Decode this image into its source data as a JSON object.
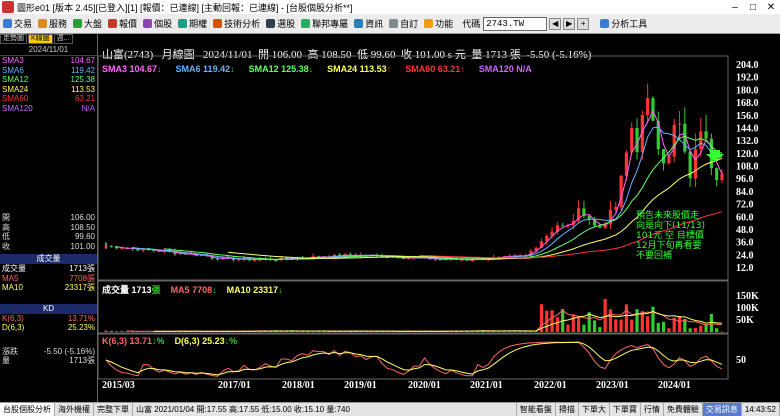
{
  "window": {
    "title": "圖形e01 [版本 2.45][已登入][1] [報價：已連線] [主動回報：已連線] - [台股個股分析**]"
  },
  "menu": {
    "items": [
      {
        "label": "交易",
        "icon": "trade-icon",
        "color": "#3a7bd5"
      },
      {
        "label": "服務",
        "icon": "service-icon",
        "color": "#e08a1e"
      },
      {
        "label": "大盤",
        "icon": "market-icon",
        "color": "#2a9d3a"
      },
      {
        "label": "報價",
        "icon": "quote-icon",
        "color": "#c0392b"
      },
      {
        "label": "個股",
        "icon": "stock-icon",
        "color": "#8e44ad"
      },
      {
        "label": "期權",
        "icon": "futures-icon",
        "color": "#16a085"
      },
      {
        "label": "技術分析",
        "icon": "chart-icon",
        "color": "#d35400"
      },
      {
        "label": "選股",
        "icon": "filter-icon",
        "color": "#2c3e50"
      },
      {
        "label": "聯邦專屬",
        "icon": "bank-icon",
        "color": "#27ae60"
      },
      {
        "label": "資訊",
        "icon": "info-icon",
        "color": "#2980b9"
      },
      {
        "label": "自訂",
        "icon": "custom-icon",
        "color": "#7f8c8d"
      },
      {
        "label": "功能",
        "icon": "function-icon",
        "color": "#f39c12"
      }
    ],
    "code_label": "代碼",
    "code_value": "2743.TW",
    "tools_label": "分析工具"
  },
  "left": {
    "tabs": [
      "走勢圖",
      "K線圖",
      "週..."
    ],
    "date": "2024/11/01",
    "ma_rows": [
      {
        "label": "SMA3",
        "value": "104.67",
        "color": "#ff66ff"
      },
      {
        "label": "SMA6",
        "value": "119.42",
        "color": "#66b3ff"
      },
      {
        "label": "SMA12",
        "value": "125.38",
        "color": "#66ff66"
      },
      {
        "label": "SMA24",
        "value": "113.53",
        "color": "#ffff66"
      },
      {
        "label": "SMA60",
        "value": "63.21",
        "color": "#ff3333"
      },
      {
        "label": "SMA120",
        "value": "N/A",
        "color": "#cc66ff"
      }
    ],
    "price_rows": [
      {
        "label": "開",
        "value": "106.00"
      },
      {
        "label": "高",
        "value": "108.50"
      },
      {
        "label": "低",
        "value": "99.60"
      },
      {
        "label": "收",
        "value": "101.00"
      }
    ],
    "vol_head": "成交量",
    "vol_rows": [
      {
        "label": "成交量",
        "value": "1713張",
        "color": "#ffffff"
      },
      {
        "label": "MA5",
        "value": "7708張",
        "color": "#ff6666"
      },
      {
        "label": "MA10",
        "value": "23317張",
        "color": "#ffff66"
      }
    ],
    "kd_head": "KD",
    "kd_rows": [
      {
        "label": "K(6,3)",
        "value": "13.71%",
        "color": "#ff6666"
      },
      {
        "label": "D(6,3)",
        "value": "25.23%",
        "color": "#ffff66"
      }
    ],
    "chg_rows": [
      {
        "label": "漲跌",
        "value": "-5.50 (-5.16%)"
      },
      {
        "label": "量",
        "value": "1713張"
      }
    ]
  },
  "header": {
    "stock": "山富(2743)",
    "period": "月線圖",
    "date": "2024/11/01",
    "open_label": "開",
    "open": "106.00",
    "high_label": "高",
    "high": "108.50",
    "low_label": "低",
    "low": "99.60",
    "close_label": "收",
    "close": "101.00",
    "unit": "s 元",
    "vol_label": "量",
    "vol": "1713 張",
    "change": "-5.50 (-5.16%)"
  },
  "legend": [
    {
      "text": "SMA3 104.67",
      "arrow": "↓",
      "color": "#ff66ff"
    },
    {
      "text": "SMA6 119.42",
      "arrow": "↓",
      "color": "#66b3ff"
    },
    {
      "text": "SMA12 125.38",
      "arrow": "↓",
      "color": "#66ff66"
    },
    {
      "text": "SMA24 113.53",
      "arrow": "↑",
      "color": "#ffff66"
    },
    {
      "text": "SMA60 63.21",
      "arrow": "↑",
      "color": "#ff3333"
    },
    {
      "text": "SMA120 N/A",
      "arrow": "",
      "color": "#cc66ff"
    }
  ],
  "price_axis": [
    "204.0",
    "192.0",
    "180.0",
    "168.0",
    "156.0",
    "144.0",
    "132.0",
    "120.0",
    "108.0",
    "96.0",
    "84.0",
    "72.0",
    "60.0",
    "48.0",
    "36.0",
    "24.0",
    "12.0"
  ],
  "vol_legend": {
    "vol": "成交量 1713",
    "vol_unit": "張",
    "ma5": "MA5 7708",
    "ma5_arrow": "↓",
    "ma10": "MA10 23317",
    "ma10_arrow": "↓"
  },
  "vol_axis": [
    "150K",
    "100K",
    "50K"
  ],
  "kd_legend": {
    "k": "K(6,3) 13.71",
    "k_arrow": "↓%",
    "d": "D(6,3) 25.23",
    "d_arrow": "↓%"
  },
  "kd_axis": [
    "50"
  ],
  "date_axis": [
    "2015/03",
    "2017/01",
    "2018/01",
    "2019/01",
    "2020/01",
    "2021/01",
    "2022/01",
    "2023/01",
    "2024/01"
  ],
  "annotation": [
    "預告未來股價走",
    "向是向下(11/13)",
    "101元 空 目標價",
    "12月下旬再看要",
    "不要回補"
  ],
  "colors": {
    "up": "#ff3333",
    "down": "#33cc33",
    "flat": "#ffffff",
    "sma3": "#ff66ff",
    "sma6": "#66b3ff",
    "sma12": "#66ff66",
    "sma24": "#ffff66",
    "sma60": "#ff3333",
    "annotation": "#33ff33"
  },
  "status": {
    "items": [
      "台股個股分析",
      "海外機權",
      "完整下單"
    ],
    "quote": "山富 2021/01/04 開:17.55 高:17.55 低:15.00 收:15.10 量:740",
    "right": [
      "智能看盤",
      "掃描",
      "下單大",
      "下單寶",
      "行情",
      "免費體驗"
    ],
    "alert": "交易訊息",
    "time": "14:43:52"
  }
}
